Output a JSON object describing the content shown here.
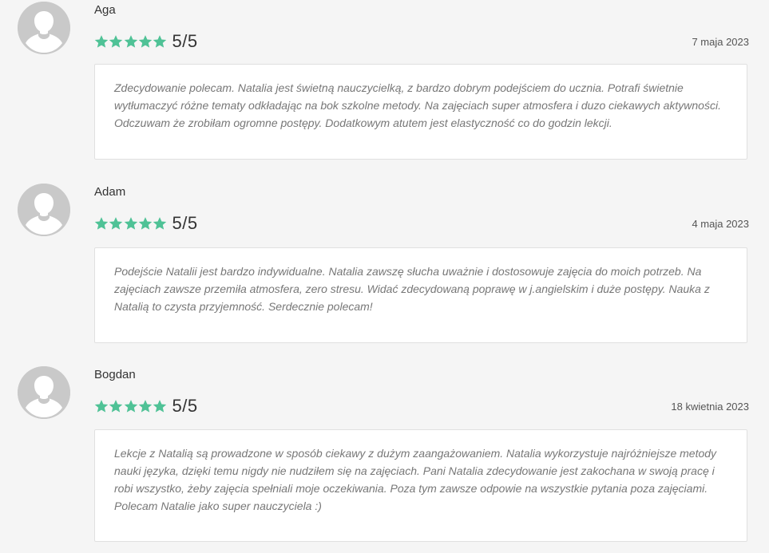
{
  "accent_color": "#4fc296",
  "reviews": [
    {
      "name": "Aga",
      "score": "5/5",
      "stars": 5,
      "date": "7 maja 2023",
      "text": "Zdecydowanie polecam. Natalia jest świetną nauczycielką, z bardzo dobrym podejściem do ucznia. Potrafi świetnie wytłumaczyć różne tematy odkładając na bok szkolne metody. Na zajęciach super atmosfera i duzo ciekawych aktywności. Odczuwam że zrobiłam ogromne postępy. Dodatkowym atutem jest elastyczność co do godzin lekcji."
    },
    {
      "name": "Adam",
      "score": "5/5",
      "stars": 5,
      "date": "4 maja 2023",
      "text": "Podejście Natalii jest bardzo indywidualne. Natalia zawszę słucha uważnie i dostosowuje zajęcia do moich potrzeb. Na zajęciach zawsze przemiła atmosfera, zero stresu. Widać zdecydowaną poprawę w j.angielskim i duże postępy. Nauka z Natalią to czysta przyjemność. Serdecznie polecam!"
    },
    {
      "name": "Bogdan",
      "score": "5/5",
      "stars": 5,
      "date": "18 kwietnia 2023",
      "text": "Lekcje z Natalią są prowadzone w sposób ciekawy z dużym zaangażowaniem. Natalia wykorzystuje najróżniejsze metody nauki języka, dzięki temu nigdy nie nudziłem się na zajęciach. Pani Natalia zdecydowanie jest zakochana w swoją pracę i robi wszystko, żeby zajęcia spełniali moje oczekiwania. Poza tym zawsze odpowie na wszystkie pytania poza zajęciami. Polecam Natalie jako super nauczyciela :)"
    }
  ]
}
